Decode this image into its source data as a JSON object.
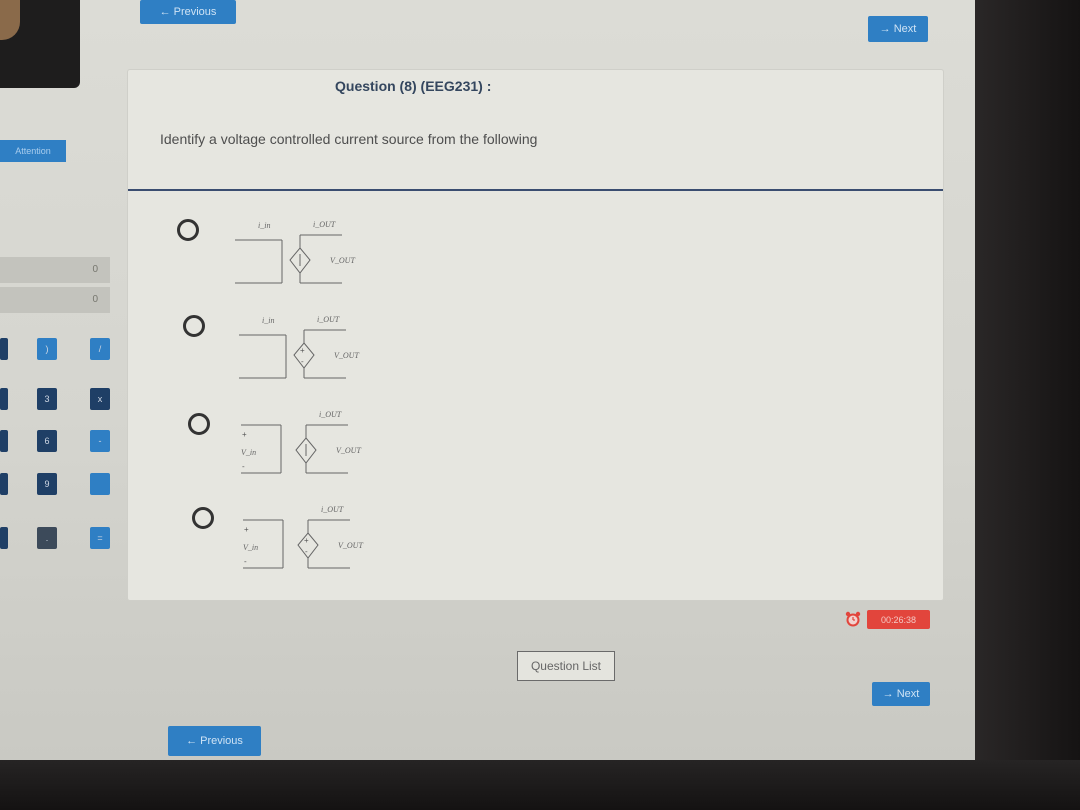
{
  "nav": {
    "previous_top_label": "← Previous",
    "next_top_label": "→ Next",
    "previous_bottom_label": "← Previous",
    "next_bottom_label": "→ Next"
  },
  "sidebar": {
    "attention_label": "Attention",
    "calculator": {
      "display_values": [
        "0",
        "0"
      ],
      "keys": [
        ")",
        "/",
        "3",
        "x",
        "6",
        "-",
        "9",
        "",
        ".",
        "="
      ]
    }
  },
  "question": {
    "title": "Question (8) (EEG231) :",
    "text": "Identify a voltage controlled current source from the following",
    "options": [
      {
        "input_label": "i_in",
        "output_current": "i_OUT",
        "output_voltage": "V_OUT",
        "source": "i"
      },
      {
        "input_label": "i_in",
        "output_current": "i_OUT",
        "output_voltage": "V_OUT",
        "source": "v"
      },
      {
        "input_label": "V_in",
        "output_current": "i_OUT",
        "output_voltage": "V_OUT",
        "source": "i"
      },
      {
        "input_label": "V_in",
        "output_current": "i_OUT",
        "output_voltage": "V_OUT",
        "source": "v"
      }
    ]
  },
  "footer": {
    "question_list_label": "Question List",
    "timer": "00:26:38"
  },
  "colors": {
    "accent": "#2f7fc4",
    "title": "#34465e",
    "divider": "#3a4d70",
    "timer": "#e2453c"
  }
}
